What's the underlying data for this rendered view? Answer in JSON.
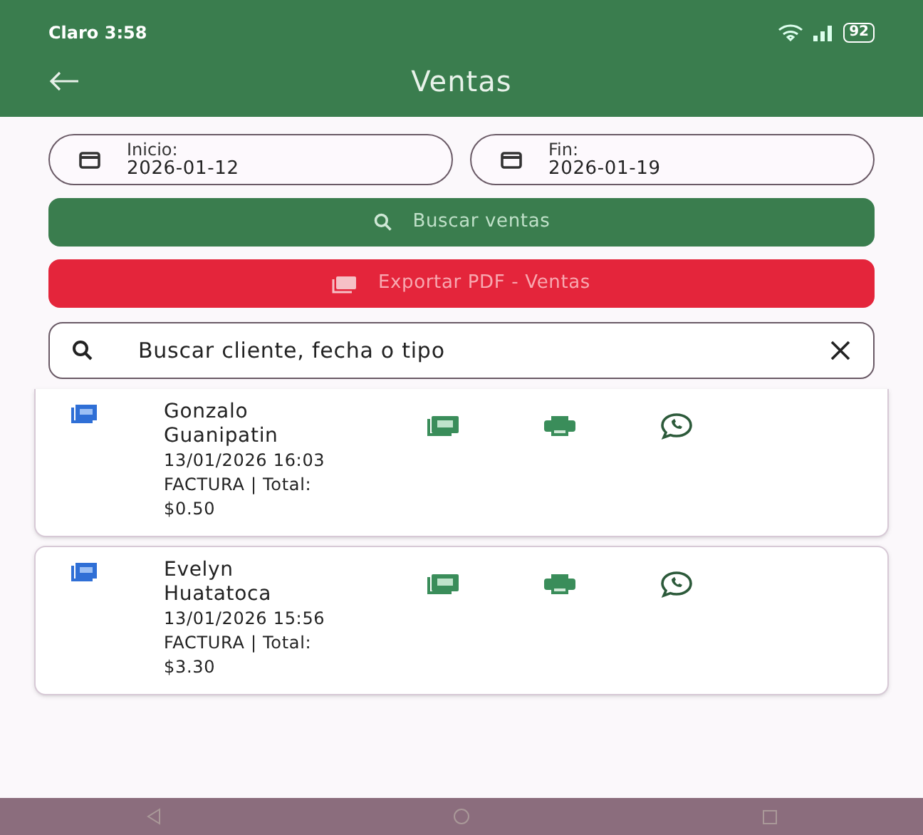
{
  "status_bar": {
    "carrier_time": "Claro 3:58",
    "battery": "92"
  },
  "app_bar": {
    "title": "Ventas"
  },
  "date_filters": [
    {
      "label": "Inicio:",
      "value": "2026-01-12"
    },
    {
      "label": "Fin:",
      "value": "2026-01-19"
    }
  ],
  "buttons": [
    {
      "kind": "search",
      "label": "Buscar ventas"
    },
    {
      "kind": "export",
      "label": "Exportar PDF - Ventas"
    }
  ],
  "search": {
    "placeholder": "Buscar cliente, fecha o tipo"
  },
  "sales": [
    {
      "client": "Gonzalo Guanipatin",
      "datetime": "13/01/2026 16:03",
      "summary": "FACTURA | Total: $0.50"
    },
    {
      "client": "Evelyn Huatatoca",
      "datetime": "13/01/2026 15:56",
      "summary": "FACTURA | Total: $3.30"
    }
  ]
}
